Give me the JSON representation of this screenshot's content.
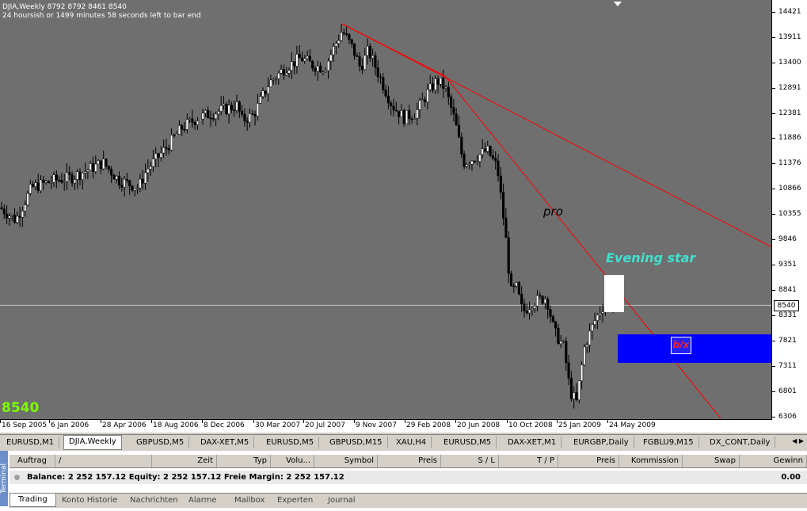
{
  "header": {
    "symbol_line": "DJIA,Weekly  8792 8792 8461 8540",
    "timer_line": "24 hoursish or 1499 minutes 58 seconds left to bar end"
  },
  "chart": {
    "big_price": "8540",
    "current_price_label": "8540",
    "price_ticks": [
      "14421",
      "13911",
      "13400",
      "12891",
      "12381",
      "11886",
      "11376",
      "10866",
      "10355",
      "9846",
      "9351",
      "8841",
      "8331",
      "7821",
      "7311",
      "6801",
      "6306"
    ],
    "time_ticks": [
      "16 Sep 2005",
      "6 Jan 2006",
      "28 Apr 2006",
      "18 Aug 2006",
      "8 Dec 2006",
      "30 Mar 2007",
      "20 Jul 2007",
      "9 Nov 2007",
      "29 Feb 2008",
      "20 Jun 2008",
      "10 Oct 2008",
      "25 Jan 2009",
      "24 May 2009"
    ],
    "annotation_pro": "pro",
    "annotation_star": "Evening star",
    "bx_icon_text": "b/x",
    "colors": {
      "plot_bg": "#6f6f6f",
      "bull": "#ffffff",
      "bear": "#000000",
      "trendline": "#ff0000",
      "blue_zone": "#0000ff",
      "big_price": "#7cfc00",
      "evening_star": "#40e0d0"
    }
  },
  "tabs": [
    {
      "label": "EURUSD,M1",
      "active": false
    },
    {
      "label": "DJIA,Weekly",
      "active": true
    },
    {
      "label": "GBPUSD,M5",
      "active": false
    },
    {
      "label": "DAX-XET,M5",
      "active": false
    },
    {
      "label": "EURUSD,M5",
      "active": false
    },
    {
      "label": "GBPUSD,M15",
      "active": false
    },
    {
      "label": "XAU,H4",
      "active": false
    },
    {
      "label": "EURUSD,M5",
      "active": false
    },
    {
      "label": "DAX-XET,M1",
      "active": false
    },
    {
      "label": "EURGBP,Daily",
      "active": false
    },
    {
      "label": "FGBLU9,M15",
      "active": false
    },
    {
      "label": "DX_CONT,Daily",
      "active": false
    }
  ],
  "terminal": {
    "side_label": "Terminal",
    "columns": [
      "Auftrag",
      "/",
      "Zeit",
      "Typ",
      "Volu...",
      "Symbol",
      "Preis",
      "S / L",
      "T / P",
      "Preis",
      "Kommission",
      "Swap",
      "Gewinn"
    ],
    "balance_text": "Balance: 2 252 157.12  Equity: 2 252 157.12  Freie Margin: 2 252 157.12",
    "balance_value": "0.00",
    "bottom_tabs": [
      "Trading",
      "Konto Historie",
      "Nachrichten",
      "Alarme",
      "Mailbox",
      "Experten",
      "Journal"
    ]
  }
}
